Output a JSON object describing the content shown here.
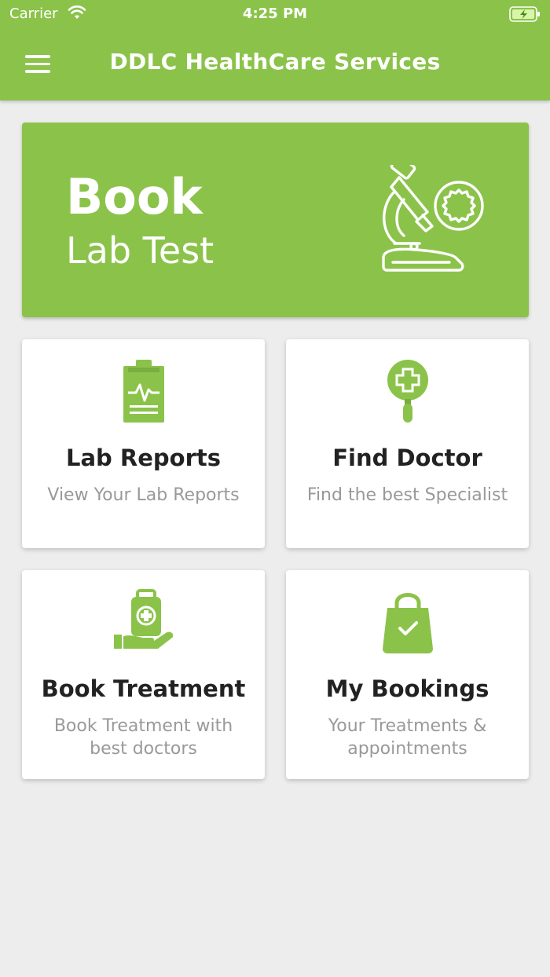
{
  "status_bar": {
    "carrier": "Carrier",
    "time": "4:25 PM"
  },
  "app": {
    "title": "DDLC HealthCare Services",
    "accent_color": "#8bc34a"
  },
  "banner": {
    "title": "Book",
    "subtitle": "Lab Test",
    "icon": "microscope-icon"
  },
  "cards": [
    {
      "title": "Lab Reports",
      "description": "View Your Lab Reports",
      "icon": "clipboard-report-icon"
    },
    {
      "title": "Find Doctor",
      "description": "Find the best Specialist",
      "icon": "medical-search-icon"
    },
    {
      "title": "Book Treatment",
      "description": "Book Treatment with best doctors",
      "icon": "medical-kit-hand-icon"
    },
    {
      "title": "My Bookings",
      "description": "Your Treatments & appointments",
      "icon": "shopping-bag-check-icon"
    }
  ]
}
